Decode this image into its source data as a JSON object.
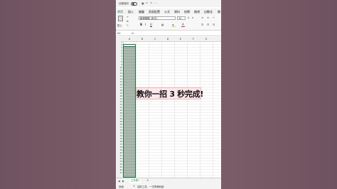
{
  "topbar": {
    "autosave_label": "自動儲存",
    "qat_icons": [
      "save-icon",
      "undo-icon",
      "redo-icon",
      "more-icon"
    ]
  },
  "ribbon_tabs": [
    {
      "label": "常用",
      "active": true
    },
    {
      "label": "插入",
      "active": false
    },
    {
      "label": "繪圖",
      "active": false
    },
    {
      "label": "頁面配置",
      "active": false
    },
    {
      "label": "公式",
      "active": false
    },
    {
      "label": "資料",
      "active": false
    },
    {
      "label": "校閱",
      "active": false
    },
    {
      "label": "檢視",
      "active": false
    },
    {
      "label": "自動化",
      "active": false
    },
    {
      "label": "開",
      "active": false
    }
  ],
  "ribbon": {
    "paste_label": "貼上",
    "font_name": "新細明體 (本文)",
    "font_size": "12",
    "bold": "B",
    "italic": "I",
    "underline": "U",
    "font_color": "A",
    "accent_color": "#107c41",
    "fill_color": "#f5d43b",
    "font_color_bar": "#e0312d"
  },
  "formula_bar": {
    "name_box": "A1",
    "fx": "fx",
    "value": ""
  },
  "columns": [
    "A",
    "B",
    "C",
    "D",
    "E",
    "F",
    "G"
  ],
  "rows": [
    "1",
    "2",
    "3",
    "4",
    "5",
    "6",
    "7",
    "8",
    "9",
    "10",
    "11",
    "12",
    "13",
    "14",
    "15",
    "16",
    "17",
    "18",
    "19",
    "20",
    "21",
    "22",
    "23",
    "24",
    "25",
    "26",
    "27",
    "28",
    "29",
    "30",
    "31",
    "32",
    "33",
    "34",
    "35",
    "36",
    "37",
    "38",
    "39",
    "40",
    "41",
    "42",
    "43",
    "44",
    "45",
    "46",
    "47"
  ],
  "sheet": {
    "tab_label": "工作表1",
    "add_label": "+"
  },
  "status": {
    "ready": "就緒",
    "accessibility": "協助工具：一切準備就緒"
  },
  "caption": "教你一招 3 秒完成!"
}
